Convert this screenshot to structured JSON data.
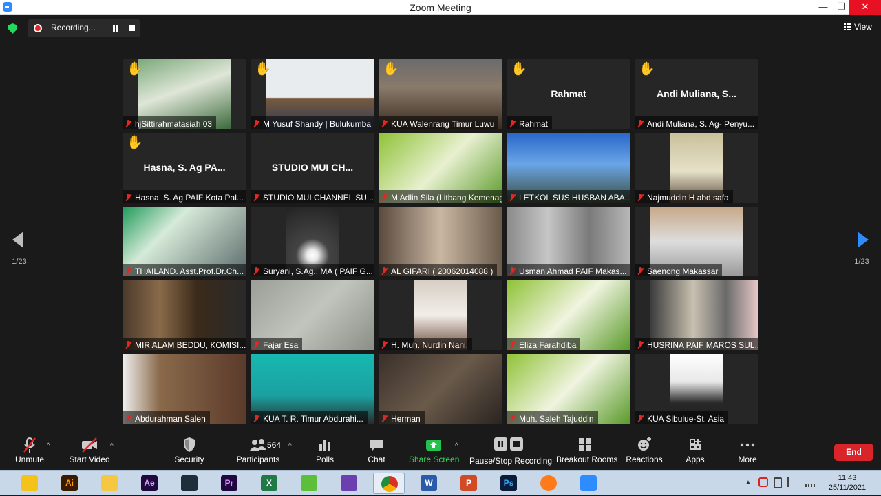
{
  "window": {
    "title": "Zoom Meeting",
    "minimize": "—",
    "maximize": "❐",
    "close": "✕"
  },
  "topbar": {
    "recording_label": "Recording...",
    "view_label": "View"
  },
  "pagination": {
    "left": "1/23",
    "right": "1/23"
  },
  "tiles": [
    {
      "name": "hjSittirahmatasiah 03",
      "big": "",
      "hand": true,
      "video": true,
      "active": false
    },
    {
      "name": "M Yusuf Shandy | Bulukumba",
      "big": "",
      "hand": true,
      "video": true,
      "active": false
    },
    {
      "name": "KUA Walenrang Timur Luwu",
      "big": "",
      "hand": true,
      "video": true,
      "active": false
    },
    {
      "name": "Rahmat",
      "big": "Rahmat",
      "hand": true,
      "video": false,
      "active": false
    },
    {
      "name": "Andi Muliana, S. Ag- Penyu...",
      "big": "Andi  Muliana,  S...",
      "hand": true,
      "video": false,
      "active": false
    },
    {
      "name": "Hasna, S. Ag PAIF Kota Pal...",
      "big": "Hasna,  S.  Ag  PA...",
      "hand": true,
      "video": false,
      "active": false
    },
    {
      "name": "STUDIO MUI CHANNEL SU...",
      "big": "STUDIO  MUI  CH...",
      "hand": false,
      "video": false,
      "active": false
    },
    {
      "name": "M Adlin Sila (Litbang Kemenag)",
      "big": "",
      "hand": false,
      "video": true,
      "active": true
    },
    {
      "name": "LETKOL SUS HUSBAN ABA...",
      "big": "",
      "hand": false,
      "video": true,
      "active": false
    },
    {
      "name": "Najmuddin H abd safa",
      "big": "",
      "hand": false,
      "video": true,
      "active": false
    },
    {
      "name": "THAILAND. Asst.Prof.Dr.Ch...",
      "big": "",
      "hand": false,
      "video": true,
      "active": false
    },
    {
      "name": "Suryani, S.Ag., MA ( PAIF  G...",
      "big": "",
      "hand": false,
      "video": true,
      "active": false
    },
    {
      "name": "AL GIFARI ( 20062014088 )",
      "big": "",
      "hand": false,
      "video": true,
      "active": false
    },
    {
      "name": "Usman Ahmad PAIF Makas...",
      "big": "",
      "hand": false,
      "video": true,
      "active": false
    },
    {
      "name": "Saenong Makassar",
      "big": "",
      "hand": false,
      "video": true,
      "active": false
    },
    {
      "name": "MIR ALAM BEDDU, KOMISI...",
      "big": "",
      "hand": false,
      "video": true,
      "active": false
    },
    {
      "name": "Fajar Esa",
      "big": "",
      "hand": false,
      "video": true,
      "active": false
    },
    {
      "name": "H. Muh. Nurdin Nani.",
      "big": "",
      "hand": false,
      "video": true,
      "active": false
    },
    {
      "name": "Eliza Farahdiba",
      "big": "",
      "hand": false,
      "video": true,
      "active": false
    },
    {
      "name": "HUSRINA PAIF MAROS SUL...",
      "big": "",
      "hand": false,
      "video": true,
      "active": false
    },
    {
      "name": "Abdurahman Saleh",
      "big": "",
      "hand": false,
      "video": true,
      "active": false
    },
    {
      "name": "KUA T. R. Timur Abdurahi...",
      "big": "",
      "hand": false,
      "video": true,
      "active": false
    },
    {
      "name": "Herman",
      "big": "",
      "hand": false,
      "video": true,
      "active": false
    },
    {
      "name": "Muh. Saleh Tajuddin",
      "big": "",
      "hand": false,
      "video": true,
      "active": false
    },
    {
      "name": "KUA Sibulue-St. Asia",
      "big": "",
      "hand": false,
      "video": true,
      "active": false
    }
  ],
  "toolbar": {
    "unmute": "Unmute",
    "start_video": "Start Video",
    "security": "Security",
    "participants": "Participants",
    "participants_count": "564",
    "polls": "Polls",
    "chat": "Chat",
    "share_screen": "Share Screen",
    "pause_stop_recording": "Pause/Stop Recording",
    "breakout_rooms": "Breakout Rooms",
    "reactions": "Reactions",
    "apps": "Apps",
    "more": "More",
    "end": "End"
  },
  "taskbar": {
    "apps": [
      {
        "icon": "inkscape-icon",
        "label": ""
      },
      {
        "icon": "illustrator-icon",
        "label": "Ai"
      },
      {
        "icon": "file-explorer-icon",
        "label": ""
      },
      {
        "icon": "after-effects-icon",
        "label": "Ae"
      },
      {
        "icon": "app-icon",
        "label": ""
      },
      {
        "icon": "premiere-icon",
        "label": "Pr"
      },
      {
        "icon": "excel-icon",
        "label": "X"
      },
      {
        "icon": "leaf-app-icon",
        "label": ""
      },
      {
        "icon": "visual-studio-icon",
        "label": ""
      },
      {
        "icon": "chrome-icon",
        "label": ""
      },
      {
        "icon": "word-icon",
        "label": "W"
      },
      {
        "icon": "powerpoint-icon",
        "label": "P"
      },
      {
        "icon": "photoshop-icon",
        "label": "Ps"
      },
      {
        "icon": "firefox-icon",
        "label": ""
      },
      {
        "icon": "zoom-icon",
        "label": ""
      }
    ],
    "time": "11:43",
    "date": "25/11/2021"
  },
  "colors": {
    "accent": "#2d8cff",
    "end_red": "#d9242a",
    "share_green": "#35d35c",
    "hand_yellow": "#f5c030",
    "active_outline": "#f2e46a"
  }
}
